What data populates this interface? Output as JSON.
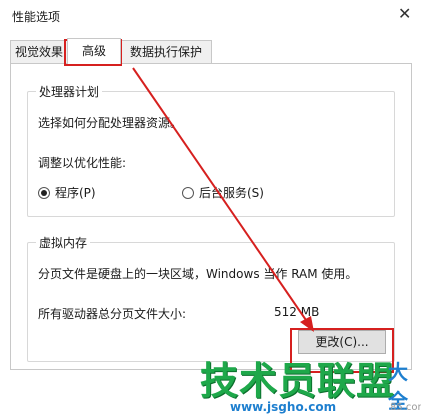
{
  "window": {
    "title": "性能选项"
  },
  "tabs": [
    {
      "label": "视觉效果"
    },
    {
      "label": "高级"
    },
    {
      "label": "数据执行保护"
    }
  ],
  "processor": {
    "group_title": "处理器计划",
    "description": "选择如何分配处理器资源。",
    "optimize_label": "调整以优化性能:",
    "option_programs": "程序(P)",
    "option_services": "后台服务(S)",
    "selected": "程序(P)"
  },
  "virtual_memory": {
    "group_title": "虚拟内存",
    "description": "分页文件是硬盘上的一块区域，Windows 当作 RAM 使用。",
    "total_label": "所有驱动器总分页文件大小:",
    "total_value": "512 MB",
    "change_button": "更改(C)..."
  },
  "watermark": {
    "text": "技术员联盟",
    "suffix": "大全",
    "url": "www.jsgho.com",
    "url2": "85.com"
  },
  "colors": {
    "highlight": "#d6201f",
    "watermark_green": "#1ea84a",
    "watermark_blue": "#1e7fcf"
  }
}
